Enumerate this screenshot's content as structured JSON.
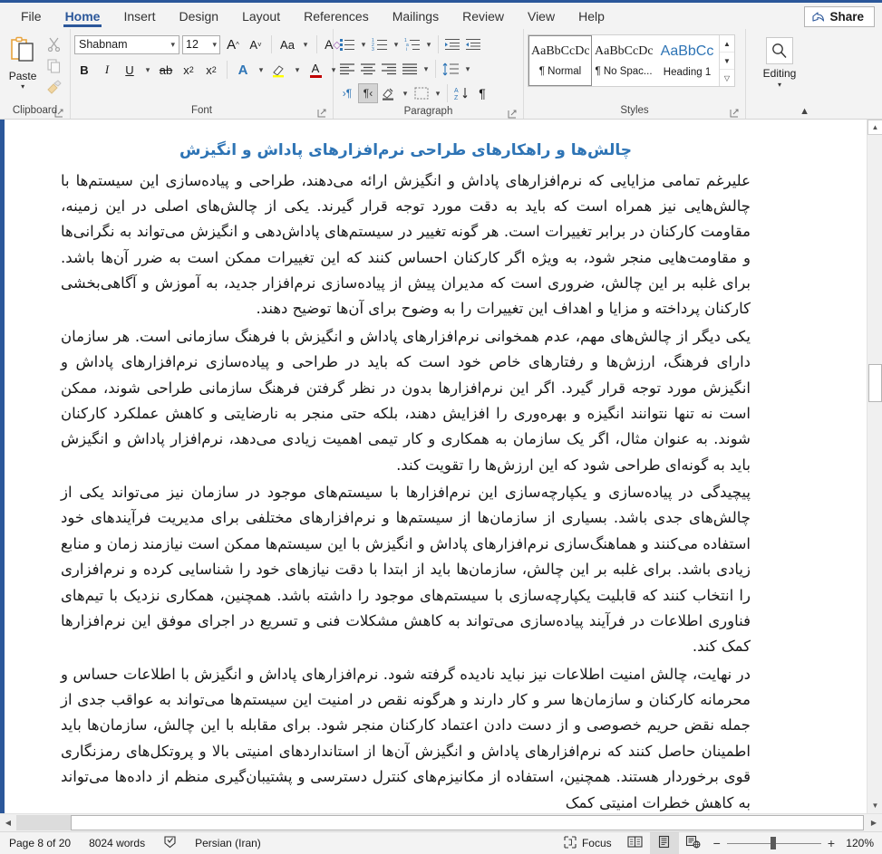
{
  "window": {
    "accent_color": "#2b579a"
  },
  "tabs": [
    {
      "label": "File",
      "active": false
    },
    {
      "label": "Home",
      "active": true
    },
    {
      "label": "Insert",
      "active": false
    },
    {
      "label": "Design",
      "active": false
    },
    {
      "label": "Layout",
      "active": false
    },
    {
      "label": "References",
      "active": false
    },
    {
      "label": "Mailings",
      "active": false
    },
    {
      "label": "Review",
      "active": false
    },
    {
      "label": "View",
      "active": false
    },
    {
      "label": "Help",
      "active": false
    }
  ],
  "share": {
    "label": "Share",
    "icon": "share-icon"
  },
  "ribbon": {
    "clipboard": {
      "group_label": "Clipboard",
      "paste_label": "Paste",
      "paste_icon": "paste-icon",
      "cut_icon": "scissors-icon",
      "copy_icon": "copy-icon",
      "format_painter_icon": "format-painter-icon",
      "dialog_launcher_icon": "dialog-launcher-icon"
    },
    "font": {
      "group_label": "Font",
      "font_name": "Shabnam",
      "font_size": "12",
      "grow_font_icon": "grow-font-icon",
      "shrink_font_icon": "shrink-font-icon",
      "change_case_icon": "change-case-icon",
      "clear_formatting_icon": "clear-formatting-icon",
      "bold": "B",
      "italic": "I",
      "underline": "U",
      "strikethrough_icon": "strikethrough-icon",
      "subscript_icon": "subscript-icon",
      "superscript_icon": "superscript-icon",
      "text_effects_icon": "text-effects-icon",
      "highlight_icon": "text-highlight-icon",
      "font_color_icon": "font-color-icon",
      "highlight_color": "#ffff00",
      "font_color": "#c00000",
      "dialog_launcher_icon": "dialog-launcher-icon"
    },
    "paragraph": {
      "group_label": "Paragraph",
      "bullets_icon": "bullets-icon",
      "numbering_icon": "numbering-icon",
      "multilevel_icon": "multilevel-list-icon",
      "decrease_indent_icon": "decrease-indent-icon",
      "increase_indent_icon": "increase-indent-icon",
      "align_left_icon": "align-left-icon",
      "align_center_icon": "align-center-icon",
      "align_right_icon": "align-right-icon",
      "justify_icon": "justify-icon",
      "line_spacing_icon": "line-spacing-icon",
      "ltr_icon": "text-direction-ltr-icon",
      "rtl_icon": "text-direction-rtl-icon",
      "rtl_active": true,
      "shading_icon": "shading-icon",
      "borders_icon": "borders-icon",
      "sort_icon": "sort-az-icon",
      "show_marks_icon": "show-formatting-marks-icon",
      "dialog_launcher_icon": "dialog-launcher-icon"
    },
    "styles": {
      "group_label": "Styles",
      "items": [
        {
          "preview": "AaBbCcDc",
          "name": "¶ Normal",
          "selected": true,
          "heading": false
        },
        {
          "preview": "AaBbCcDc",
          "name": "¶ No Spac...",
          "selected": false,
          "heading": false
        },
        {
          "preview": "AaBbCc",
          "name": "Heading 1",
          "selected": false,
          "heading": true
        }
      ],
      "scroll_up_icon": "scroll-up-icon",
      "scroll_down_icon": "scroll-down-icon",
      "more_styles_icon": "more-styles-icon",
      "dialog_launcher_icon": "dialog-launcher-icon"
    },
    "editing": {
      "group_label": "",
      "label": "Editing",
      "icon": "search-icon"
    },
    "collapse_icon": "collapse-ribbon-icon"
  },
  "document": {
    "heading": "چالش‌ها و راهکارهای طراحی نرم‌افزارهای پاداش و انگیزش",
    "paragraphs": [
      "علیرغم تمامی مزایایی که نرم‌افزارهای پاداش و انگیزش ارائه می‌دهند، طراحی و پیاده‌سازی این سیستم‌ها با چالش‌هایی نیز همراه است که باید به دقت مورد توجه قرار گیرند. یکی از چالش‌های اصلی در این زمینه، مقاومت کارکنان در برابر تغییرات است. هر گونه تغییر در سیستم‌های پاداش‌دهی و انگیزش می‌تواند به نگرانی‌ها و مقاومت‌هایی منجر شود، به ویژه اگر کارکنان احساس کنند که این تغییرات ممکن است به ضرر آن‌ها باشد. برای غلبه بر این چالش، ضروری است که مدیران پیش از پیاده‌سازی نرم‌افزار جدید، به آموزش و آگاهی‌بخشی کارکنان پرداخته و مزایا و اهداف این تغییرات را به وضوح برای آن‌ها توضیح دهند.",
      "یکی دیگر از چالش‌های مهم، عدم همخوانی نرم‌افزارهای پاداش و انگیزش با فرهنگ سازمانی است. هر سازمان دارای فرهنگ، ارزش‌ها و رفتارهای خاص خود است که باید در طراحی و پیاده‌سازی نرم‌افزارهای پاداش و انگیزش مورد توجه قرار گیرد. اگر این نرم‌افزارها بدون در نظر گرفتن فرهنگ سازمانی طراحی شوند، ممکن است نه تنها نتوانند انگیزه و بهره‌وری را افزایش دهند، بلکه حتی منجر به نارضایتی و کاهش عملکرد کارکنان شوند. به عنوان مثال، اگر یک سازمان به همکاری و کار تیمی اهمیت زیادی می‌دهد، نرم‌افزار پاداش و انگیزش باید به گونه‌ای طراحی شود که این ارزش‌ها را تقویت کند.",
      "پیچیدگی در پیاده‌سازی و یکپارچه‌سازی این نرم‌افزارها با سیستم‌های موجود در سازمان نیز می‌تواند یکی از چالش‌های جدی باشد. بسیاری از سازمان‌ها از سیستم‌ها و نرم‌افزارهای مختلفی برای مدیریت فرآیندهای خود استفاده می‌کنند و هماهنگ‌سازی نرم‌افزارهای پاداش و انگیزش با این سیستم‌ها ممکن است نیازمند زمان و منابع زیادی باشد. برای غلبه بر این چالش، سازمان‌ها باید از ابتدا با دقت نیازهای خود را شناسایی کرده و نرم‌افزاری را انتخاب کنند که قابلیت یکپارچه‌سازی با سیستم‌های موجود را داشته باشد. همچنین، همکاری نزدیک با تیم‌های فناوری اطلاعات در فرآیند پیاده‌سازی می‌تواند به کاهش مشکلات فنی و تسریع در اجرای موفق این نرم‌افزارها کمک کند.",
      "در نهایت، چالش امنیت اطلاعات نیز نباید نادیده گرفته شود. نرم‌افزارهای پاداش و انگیزش با اطلاعات حساس و محرمانه کارکنان و سازمان‌ها سر و کار دارند و هرگونه نقص در امنیت این سیستم‌ها می‌تواند به عواقب جدی از جمله نقض حریم خصوصی و از دست دادن اعتماد کارکنان منجر شود. برای مقابله با این چالش، سازمان‌ها باید اطمینان حاصل کنند که نرم‌افزارهای پاداش و انگیزش آن‌ها از استانداردهای امنیتی بالا و پروتکل‌های رمزنگاری قوی برخوردار هستند. همچنین، استفاده از مکانیزم‌های کنترل دسترسی و پشتیبان‌گیری منظم از داده‌ها می‌تواند به کاهش خطرات امنیتی کمک"
    ]
  },
  "statusbar": {
    "page_info": "Page 8 of 20",
    "word_count": "8024 words",
    "proofing_icon": "proofing-errors-icon",
    "language": "Persian (Iran)",
    "focus_label": "Focus",
    "focus_icon": "focus-mode-icon",
    "read_mode_icon": "read-mode-icon",
    "print_layout_icon": "print-layout-icon",
    "web_layout_icon": "web-layout-icon",
    "active_view": "print-layout",
    "zoom_out": "−",
    "zoom_in": "+",
    "zoom_level": "120%"
  },
  "scrollbars": {
    "v_up_icon": "scroll-up-arrow-icon",
    "v_down_icon": "scroll-down-arrow-icon",
    "h_left_icon": "scroll-left-arrow-icon",
    "h_right_icon": "scroll-right-arrow-icon"
  }
}
